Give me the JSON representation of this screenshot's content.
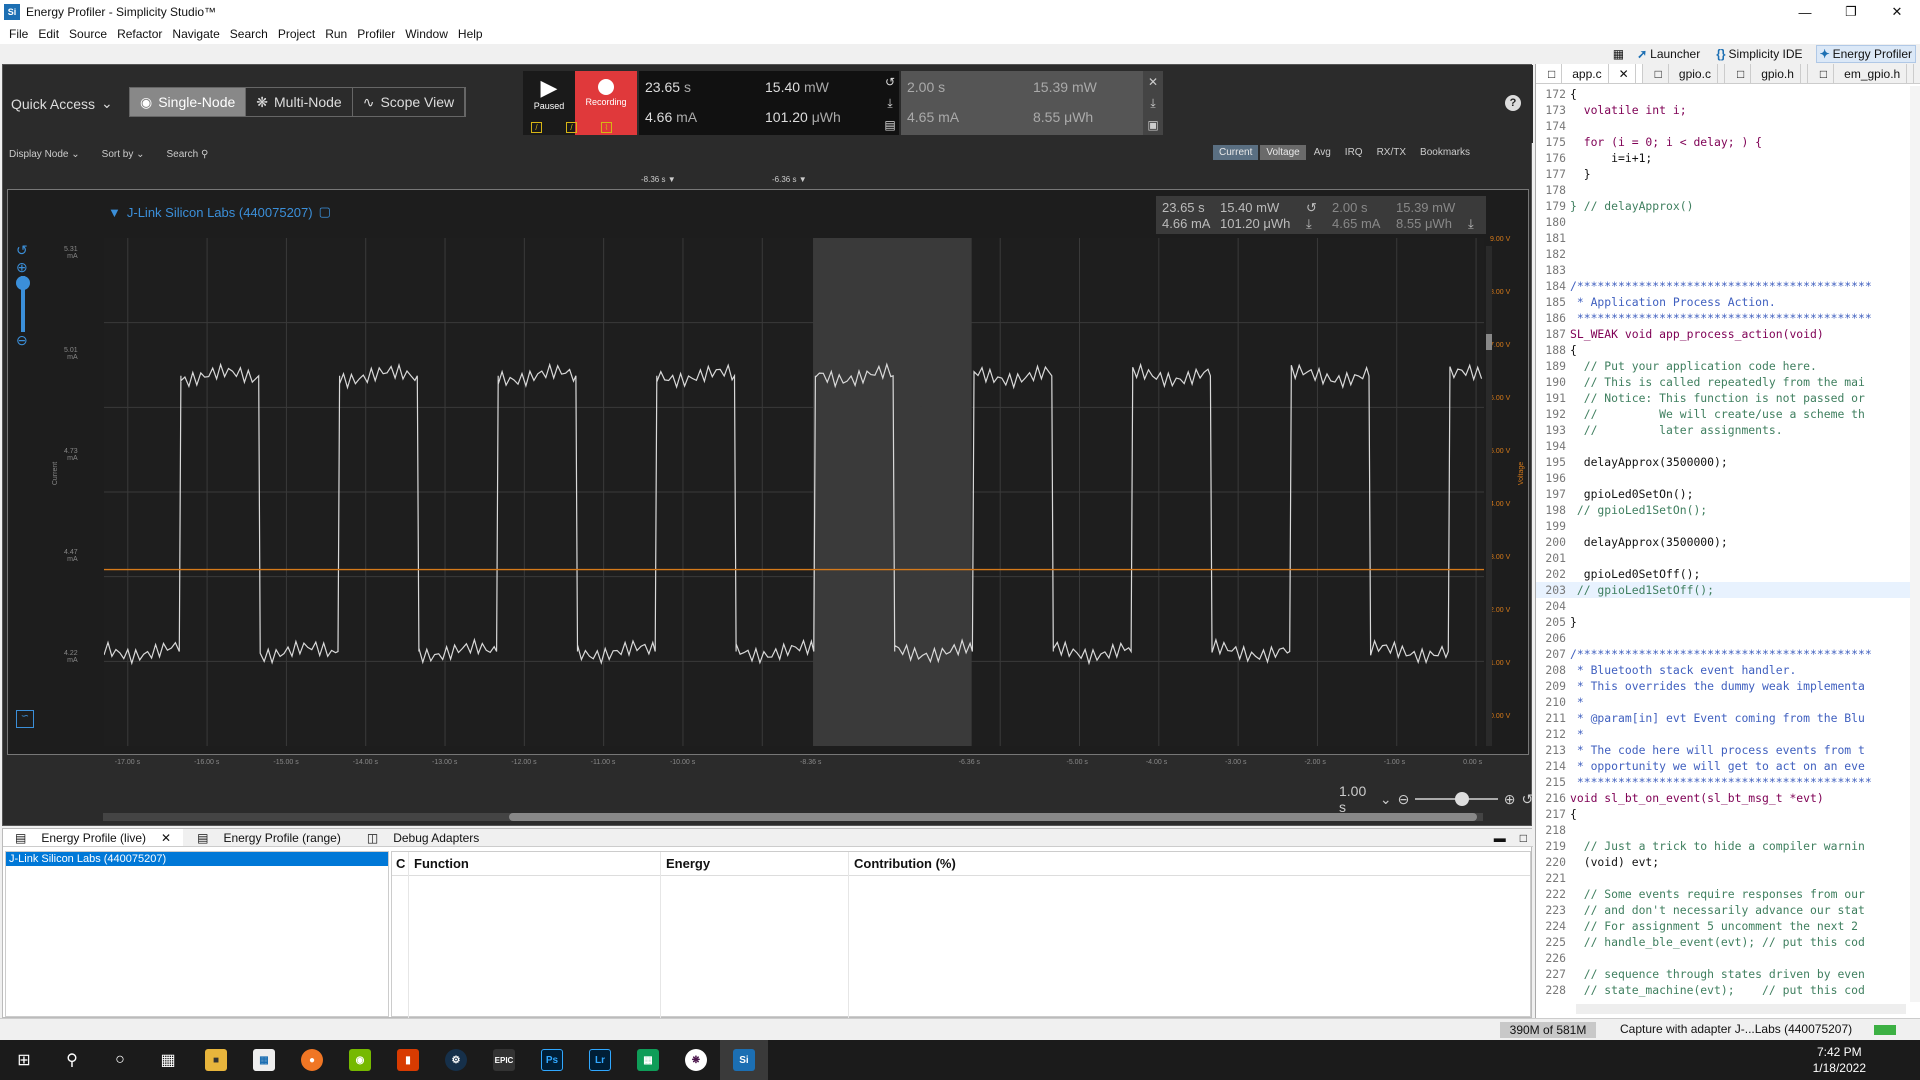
{
  "window": {
    "title": "Energy Profiler - Simplicity Studio™",
    "logo": "Si"
  },
  "menu": [
    "File",
    "Edit",
    "Source",
    "Refactor",
    "Navigate",
    "Search",
    "Project",
    "Run",
    "Profiler",
    "Window",
    "Help"
  ],
  "perspectives": [
    {
      "label": "Launcher",
      "icon": "launcher-icon"
    },
    {
      "label": "Simplicity IDE",
      "icon": "brackets-icon"
    },
    {
      "label": "Energy Profiler",
      "icon": "energy-profiler-icon",
      "active": true
    }
  ],
  "profiler": {
    "quick_access": "Quick Access",
    "modes": [
      {
        "label": "Single-Node",
        "active": true
      },
      {
        "label": "Multi-Node",
        "active": false
      },
      {
        "label": "Scope View",
        "active": false
      }
    ],
    "play_label": "Paused",
    "record_label": "Recording",
    "readout_main": {
      "time": "23.65",
      "time_unit": "s",
      "current": "4.66",
      "current_unit": "mA",
      "power": "15.40",
      "power_unit": "mW",
      "energy": "101.20",
      "energy_unit": "μWh"
    },
    "readout_sel": {
      "time": "2.00",
      "time_unit": "s",
      "current": "4.65",
      "current_unit": "mA",
      "power": "15.39",
      "power_unit": "mW",
      "energy": "8.55",
      "energy_unit": "μWh"
    },
    "sub_left": [
      "Display Node",
      "Sort by",
      "Search"
    ],
    "sub_right": [
      "Current",
      "Voltage",
      "Avg",
      "IRQ",
      "RX/TX",
      "Bookmarks"
    ],
    "markers": [
      "-8.36 s",
      "-6.36 s"
    ],
    "device": "J-Link Silicon Labs (440075207)",
    "chart_readout": {
      "time": "23.65",
      "time_unit": "s",
      "current": "4.66",
      "current_unit": "mA",
      "power": "15.40",
      "power_unit": "mW",
      "energy": "101.20",
      "energy_unit": "μWh",
      "sel_time": "2.00",
      "sel_current": "4.65",
      "sel_power": "15.39",
      "sel_energy": "8.55"
    },
    "y_left_label": "Current",
    "y_right_label": "Voltage",
    "zoom_level": "1.00 s"
  },
  "chart_data": {
    "type": "line",
    "xlabel": "",
    "ylabel_left": "Current",
    "ylabel_right": "Voltage",
    "x_ticks": [
      "-17.00 s",
      "-16.00 s",
      "-15.00 s",
      "-14.00 s",
      "-13.00 s",
      "-12.00 s",
      "-11.00 s",
      "-10.00 s",
      "-8.36 s",
      "-6.36 s",
      "-5.00 s",
      "-4.00 s",
      "-3.00 s",
      "-2.00 s",
      "-1.00 s",
      "0.00 s"
    ],
    "y_ticks_left": [
      {
        "label": "5.31",
        "unit": "mA"
      },
      {
        "label": "5.01",
        "unit": "mA"
      },
      {
        "label": "4.73",
        "unit": "mA"
      },
      {
        "label": "4.47",
        "unit": "mA"
      },
      {
        "label": "4.22",
        "unit": "mA"
      }
    ],
    "y_ticks_right": [
      "9.00 V",
      "8.00 V",
      "7.00 V",
      "6.00 V",
      "5.00 V",
      "4.00 V",
      "3.00 V",
      "2.00 V",
      "1.00 V",
      "0.00 V"
    ],
    "xlim": [
      -17.3,
      0.1
    ],
    "ylim_left": [
      4.06,
      5.35
    ],
    "series": [
      {
        "name": "Current",
        "color": "#d9d9d9",
        "kind": "square",
        "high_mA": 5.0,
        "low_mA": 4.3,
        "period_s": 2.0,
        "rise_times_s": [
          -16.35,
          -14.35,
          -12.35,
          -10.35,
          -8.35,
          -6.35,
          -4.35,
          -2.35,
          -0.35
        ],
        "fall_times_s": [
          -15.35,
          -13.35,
          -11.35,
          -9.35,
          -7.35,
          -5.35,
          -3.35,
          -1.35
        ]
      },
      {
        "name": "Voltage",
        "color": "#d67a1a",
        "kind": "flat",
        "value_V": 3.3
      }
    ],
    "selection_s": [
      -8.36,
      -6.36
    ],
    "grid": true
  },
  "bottom": {
    "tabs": [
      {
        "label": "Energy Profile (live)",
        "active": true
      },
      {
        "label": "Energy Profile (range)",
        "active": false
      },
      {
        "label": "Debug Adapters",
        "active": false
      }
    ],
    "node": "J-Link Silicon Labs (440075207)",
    "columns": [
      "C",
      "Function",
      "Energy",
      "Contribution (%)"
    ]
  },
  "editor": {
    "tabs": [
      {
        "label": "app.c",
        "active": true
      },
      {
        "label": "gpio.c",
        "active": false
      },
      {
        "label": "gpio.h",
        "active": false
      },
      {
        "label": "em_gpio.h",
        "active": false
      }
    ],
    "lines": [
      {
        "n": "172",
        "t": "{"
      },
      {
        "n": "173",
        "t": "  volatile int i;"
      },
      {
        "n": "174",
        "t": ""
      },
      {
        "n": "175",
        "t": "  for (i = 0; i < delay; ) {"
      },
      {
        "n": "176",
        "t": "      i=i+1;"
      },
      {
        "n": "177",
        "t": "  }"
      },
      {
        "n": "178",
        "t": ""
      },
      {
        "n": "179",
        "t": "} // delayApprox()"
      },
      {
        "n": "180",
        "t": ""
      },
      {
        "n": "181",
        "t": ""
      },
      {
        "n": "182",
        "t": ""
      },
      {
        "n": "183",
        "t": ""
      },
      {
        "n": "184",
        "t": "/*******************************************"
      },
      {
        "n": "185",
        "t": " * Application Process Action."
      },
      {
        "n": "186",
        "t": " *******************************************"
      },
      {
        "n": "187",
        "t": "SL_WEAK void app_process_action(void)"
      },
      {
        "n": "188",
        "t": "{"
      },
      {
        "n": "189",
        "t": "  // Put your application code here."
      },
      {
        "n": "190",
        "t": "  // This is called repeatedly from the mai"
      },
      {
        "n": "191",
        "t": "  // Notice: This function is not passed or"
      },
      {
        "n": "192",
        "t": "  //         We will create/use a scheme th"
      },
      {
        "n": "193",
        "t": "  //         later assignments."
      },
      {
        "n": "194",
        "t": ""
      },
      {
        "n": "195",
        "t": "  delayApprox(3500000);"
      },
      {
        "n": "196",
        "t": ""
      },
      {
        "n": "197",
        "t": "  gpioLed0SetOn();"
      },
      {
        "n": "198",
        "t": " // gpioLed1SetOn();"
      },
      {
        "n": "199",
        "t": ""
      },
      {
        "n": "200",
        "t": "  delayApprox(3500000);"
      },
      {
        "n": "201",
        "t": ""
      },
      {
        "n": "202",
        "t": "  gpioLed0SetOff();"
      },
      {
        "n": "203",
        "t": " // gpioLed1SetOff();"
      },
      {
        "n": "204",
        "t": ""
      },
      {
        "n": "205",
        "t": "}"
      },
      {
        "n": "206",
        "t": ""
      },
      {
        "n": "207",
        "t": "/*******************************************"
      },
      {
        "n": "208",
        "t": " * Bluetooth stack event handler."
      },
      {
        "n": "209",
        "t": " * This overrides the dummy weak implementa"
      },
      {
        "n": "210",
        "t": " *"
      },
      {
        "n": "211",
        "t": " * @param[in] evt Event coming from the Blu"
      },
      {
        "n": "212",
        "t": " *"
      },
      {
        "n": "213",
        "t": " * The code here will process events from t"
      },
      {
        "n": "214",
        "t": " * opportunity we will get to act on an eve"
      },
      {
        "n": "215",
        "t": " *******************************************"
      },
      {
        "n": "216",
        "t": "void sl_bt_on_event(sl_bt_msg_t *evt)"
      },
      {
        "n": "217",
        "t": "{"
      },
      {
        "n": "218",
        "t": ""
      },
      {
        "n": "219",
        "t": "  // Just a trick to hide a compiler warnin"
      },
      {
        "n": "220",
        "t": "  (void) evt;"
      },
      {
        "n": "221",
        "t": ""
      },
      {
        "n": "222",
        "t": "  // Some events require responses from our"
      },
      {
        "n": "223",
        "t": "  // and don't necessarily advance our stat"
      },
      {
        "n": "224",
        "t": "  // For assignment 5 uncomment the next 2"
      },
      {
        "n": "225",
        "t": "  // handle_ble_event(evt); // put this cod"
      },
      {
        "n": "226",
        "t": ""
      },
      {
        "n": "227",
        "t": "  // sequence through states driven by even"
      },
      {
        "n": "228",
        "t": "  // state_machine(evt);    // put this cod"
      }
    ]
  },
  "status": {
    "memory": "390M of 581M",
    "capture": "Capture with adapter J-...Labs (440075207)"
  },
  "taskbar": {
    "items": [
      {
        "icon": "windows-start-icon"
      },
      {
        "icon": "search-icon"
      },
      {
        "icon": "cortana-icon"
      },
      {
        "icon": "task-view-icon"
      },
      {
        "icon": "file-explorer-icon"
      },
      {
        "icon": "store-icon"
      },
      {
        "icon": "firefox-icon"
      },
      {
        "icon": "nvidia-icon"
      },
      {
        "icon": "office-icon"
      },
      {
        "icon": "steam-icon"
      },
      {
        "icon": "epic-games-icon",
        "text": "EPIC"
      },
      {
        "icon": "photoshop-icon",
        "text": "Ps"
      },
      {
        "icon": "lightroom-icon",
        "text": "Lr"
      },
      {
        "icon": "sheets-icon"
      },
      {
        "icon": "slack-icon"
      },
      {
        "icon": "simplicity-studio-icon",
        "text": "Si",
        "active": true
      }
    ],
    "time": "7:42 PM",
    "date": "1/18/2022"
  },
  "colors": {
    "accent": "#3b8fd9",
    "record": "#e0393b",
    "voltage": "#d67a1a",
    "trace": "#d9d9d9"
  }
}
